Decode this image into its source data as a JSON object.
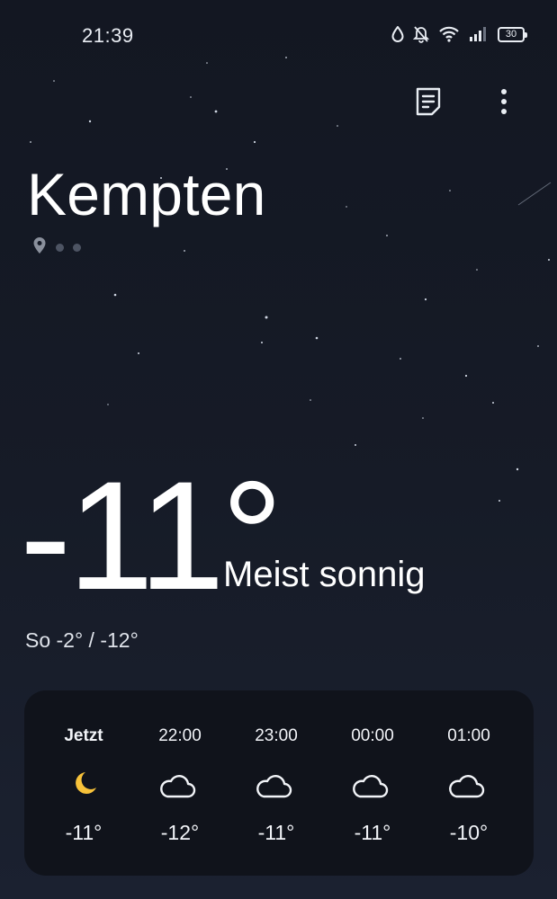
{
  "status_bar": {
    "time": "21:39",
    "battery": "30",
    "icons": [
      "drop-icon",
      "bell-off-icon",
      "wifi-icon",
      "signal-icon",
      "battery-icon"
    ]
  },
  "actions": {
    "icons": [
      "document-icon",
      "more-vert-icon"
    ]
  },
  "city": "Kempten",
  "current": {
    "temperature": "-11°",
    "condition": "Meist sonnig",
    "day_range": "So -2° / -12°"
  },
  "hourly": [
    {
      "label": "Jetzt",
      "temp": "-11°",
      "icon": "moon-icon"
    },
    {
      "label": "22:00",
      "temp": "-12°",
      "icon": "cloud-moon-icon"
    },
    {
      "label": "23:00",
      "temp": "-11°",
      "icon": "cloud-moon-icon"
    },
    {
      "label": "00:00",
      "temp": "-11°",
      "icon": "cloud-moon-icon"
    },
    {
      "label": "01:00",
      "temp": "-10°",
      "icon": "cloud-moon-icon"
    }
  ],
  "colors": {
    "background": "#161b27",
    "card": "#10131b",
    "moon": "#f7c23a",
    "text": "#ffffff"
  }
}
